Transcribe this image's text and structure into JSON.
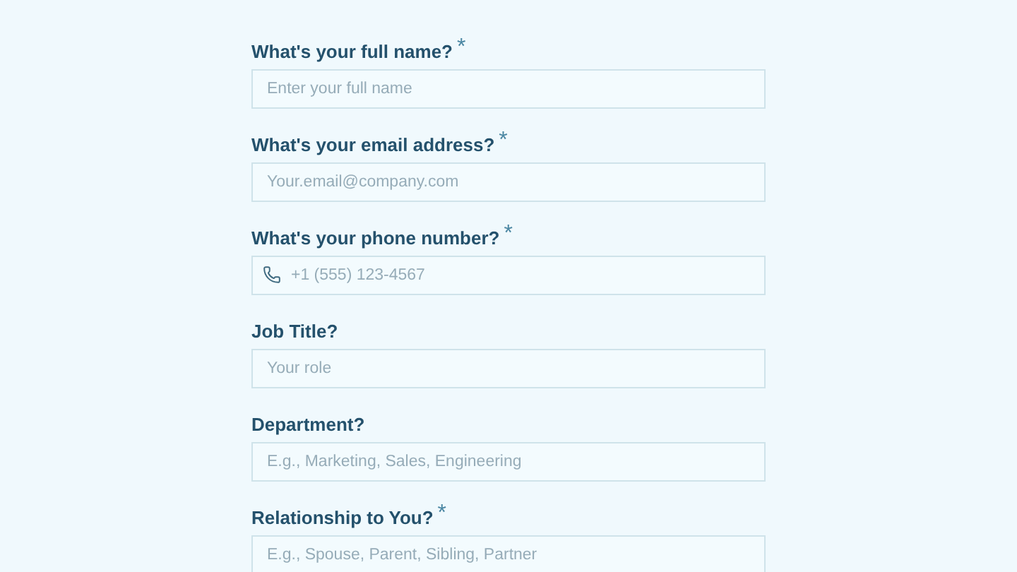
{
  "fields": [
    {
      "label": "What's your full name?",
      "required_mark": "*",
      "placeholder": "Enter your full name"
    },
    {
      "label": "What's your email address?",
      "required_mark": "*",
      "placeholder": "Your.email@company.com"
    },
    {
      "label": "What's your phone number?",
      "required_mark": "*",
      "placeholder": "+1 (555) 123-4567",
      "kind": "phone"
    },
    {
      "label": "Job Title?",
      "placeholder": "Your role"
    },
    {
      "label": "Department?",
      "placeholder": "E.g., Marketing, Sales, Engineering"
    },
    {
      "label": "Relationship to You?",
      "required_mark": "*",
      "placeholder": "E.g., Spouse, Parent, Sibling, Partner"
    }
  ]
}
